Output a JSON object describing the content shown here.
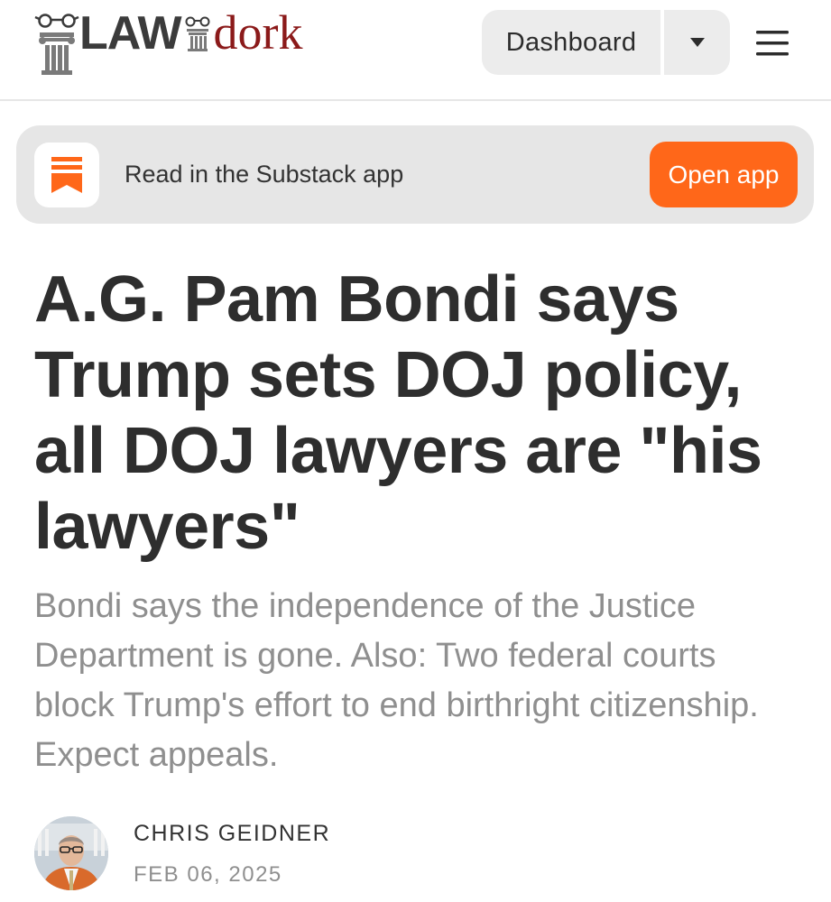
{
  "header": {
    "logo_law": "LAW",
    "logo_dork": "dork",
    "dashboard_label": "Dashboard",
    "dropdown_icon": "caret-down-icon",
    "menu_icon": "hamburger-menu-icon"
  },
  "app_banner": {
    "icon": "substack-bookmark-icon",
    "text": "Read in the Substack app",
    "button_label": "Open app",
    "accent_color": "#ff6719"
  },
  "article": {
    "title": "A.G. Pam Bondi says Trump sets DOJ policy, all DOJ lawyers are \"his lawyers\"",
    "subtitle": "Bondi says the independence of the Justice Department is gone. Also: Two federal courts block Trump's effort to end birthright citizenship. Expect appeals.",
    "author": "CHRIS GEIDNER",
    "date": "FEB 06, 2025"
  }
}
